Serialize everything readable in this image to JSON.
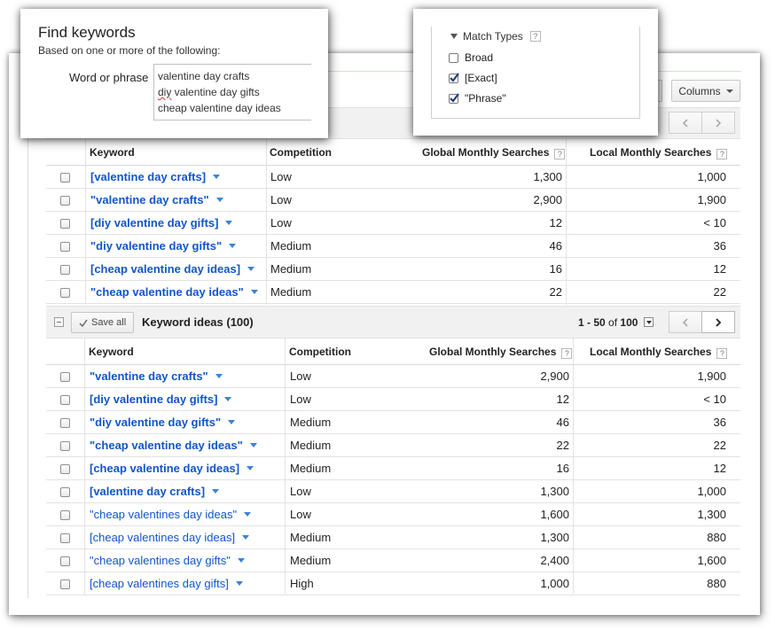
{
  "find_keywords": {
    "title": "Find keywords",
    "subtitle": "Based on one or more of the following:",
    "word_label": "Word or phrase",
    "phrases": [
      "valentine day crafts",
      "diy",
      " valentine day gifts",
      "cheap valentine day ideas"
    ]
  },
  "match_types": {
    "label": "Match Types",
    "help": "?",
    "options": [
      {
        "label": "Broad",
        "checked": false
      },
      {
        "label": "[Exact]",
        "checked": true
      },
      {
        "label": "\"Phrase\"",
        "checked": true
      }
    ]
  },
  "toolbar": {
    "columns_label": "Columns"
  },
  "search_terms": {
    "headers": {
      "keyword": "Keyword",
      "competition": "Competition",
      "global": "Global Monthly Searches",
      "local": "Local Monthly Searches",
      "help": "?"
    },
    "rows": [
      {
        "keyword": "[valentine day crafts]",
        "competition": "Low",
        "global": "1,300",
        "local": "1,000"
      },
      {
        "keyword": "\"valentine day crafts\"",
        "competition": "Low",
        "global": "2,900",
        "local": "1,900"
      },
      {
        "keyword": "[diy valentine day gifts]",
        "competition": "Low",
        "global": "12",
        "local": "< 10"
      },
      {
        "keyword": "\"diy valentine day gifts\"",
        "competition": "Medium",
        "global": "46",
        "local": "36"
      },
      {
        "keyword": "[cheap valentine day ideas]",
        "competition": "Medium",
        "global": "16",
        "local": "12"
      },
      {
        "keyword": "\"cheap valentine day ideas\"",
        "competition": "Medium",
        "global": "22",
        "local": "22"
      }
    ]
  },
  "ideas_bar": {
    "save_all": "Save all",
    "title": "Keyword ideas (100)",
    "range": "1 - 50",
    "of": "of",
    "total": "100"
  },
  "keyword_ideas": {
    "headers": {
      "keyword": "Keyword",
      "competition": "Competition",
      "global": "Global Monthly Searches",
      "local": "Local Monthly Searches",
      "help": "?"
    },
    "rows": [
      {
        "keyword": "\"valentine day crafts\"",
        "competition": "Low",
        "global": "2,900",
        "local": "1,900"
      },
      {
        "keyword": "[diy valentine day gifts]",
        "competition": "Low",
        "global": "12",
        "local": "< 10"
      },
      {
        "keyword": "\"diy valentine day gifts\"",
        "competition": "Medium",
        "global": "46",
        "local": "36"
      },
      {
        "keyword": "\"cheap valentine day ideas\"",
        "competition": "Medium",
        "global": "22",
        "local": "22"
      },
      {
        "keyword": "[cheap valentine day ideas]",
        "competition": "Medium",
        "global": "16",
        "local": "12"
      },
      {
        "keyword": "[valentine day crafts]",
        "competition": "Low",
        "global": "1,300",
        "local": "1,000"
      },
      {
        "keyword": "\"cheap valentines day ideas\"",
        "competition": "Low",
        "global": "1,600",
        "local": "1,300"
      },
      {
        "keyword": "[cheap valentines day ideas]",
        "competition": "Medium",
        "global": "1,300",
        "local": "880"
      },
      {
        "keyword": "\"cheap valentines day gifts\"",
        "competition": "Medium",
        "global": "2,400",
        "local": "1,600"
      },
      {
        "keyword": "[cheap valentines day gifts]",
        "competition": "High",
        "global": "1,000",
        "local": "880"
      }
    ]
  },
  "colors": {
    "link": "#1155cc",
    "caret": "#3b83d6"
  }
}
